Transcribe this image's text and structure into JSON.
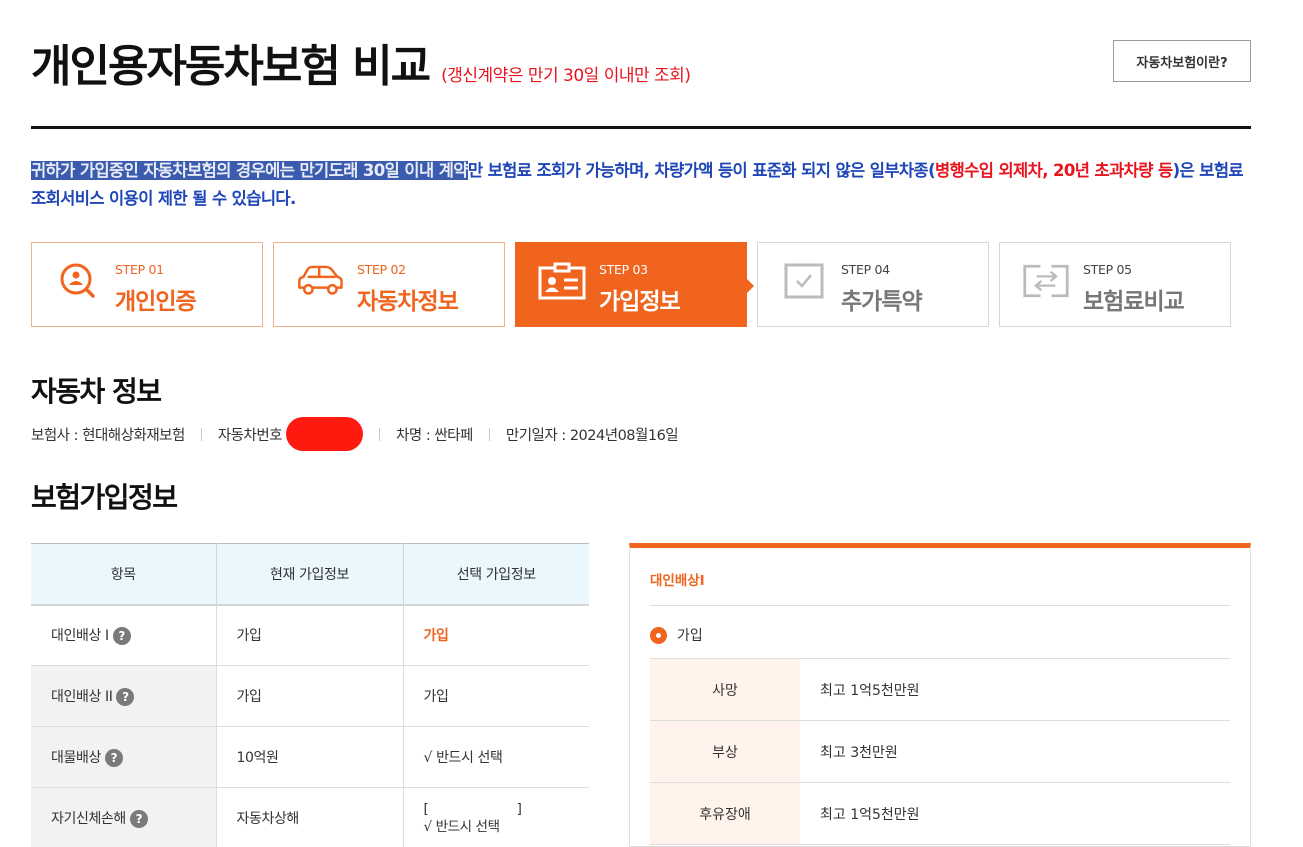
{
  "header": {
    "title": "개인용자동차보험 비교",
    "subtitle": "(갱신계약은 만기 30일 이내만 조회)",
    "about_button": "자동차보험이란?"
  },
  "notice": {
    "highlighted": "귀하가 가입중인 자동차보험의 경우에는 만기도래 30일 이내 계약",
    "part2": "만 보험료 조회가 가능하며, 차량가액 등이 표준화 되지 않은 일부차종(",
    "red": "병행수입 외제차, 20년 초과차량 등",
    "part3": ")은 보험료 조회서비스 이용이 제한 될 수 있습니다."
  },
  "steps": [
    {
      "num": "STEP 01",
      "name": "개인인증",
      "icon": "person-search-icon"
    },
    {
      "num": "STEP 02",
      "name": "자동차정보",
      "icon": "car-icon"
    },
    {
      "num": "STEP 03",
      "name": "가입정보",
      "icon": "id-card-icon"
    },
    {
      "num": "STEP 04",
      "name": "추가특약",
      "icon": "checkbox-icon"
    },
    {
      "num": "STEP 05",
      "name": "보험료비교",
      "icon": "compare-arrows-icon"
    }
  ],
  "car_section": {
    "heading": "자동차 정보",
    "insurer": "보험사 : 현대해상화재보험",
    "plate_label": "자동차번호",
    "car_name": "차명 : 싼타페",
    "expiry": "만기일자 : 2024년08월16일"
  },
  "insurance_section": {
    "heading": "보험가입정보",
    "columns": [
      "항목",
      "현재 가입정보",
      "선택 가입정보"
    ],
    "rows": [
      {
        "item": "대인배상 I",
        "current": "가입",
        "selected": "가입"
      },
      {
        "item": "대인배상 II",
        "current": "가입",
        "selected": "가입"
      },
      {
        "item": "대물배상",
        "current": "10억원",
        "selected": "√ 반드시 선택"
      },
      {
        "item": "자기신체손해",
        "current": "자동차상해",
        "selected_bracket_open": "[",
        "selected_bracket_close": "]",
        "selected": "√ 반드시 선택"
      }
    ]
  },
  "panel": {
    "title": "대인배상I",
    "option": "가입",
    "rows": [
      {
        "k": "사망",
        "v": "최고 1억5천만원"
      },
      {
        "k": "부상",
        "v": "최고 3천만원"
      },
      {
        "k": "후유장애",
        "v": "최고 1억5천만원"
      }
    ]
  },
  "colors": {
    "accent": "#f0641e",
    "notice_blue": "#1f46b7",
    "alert_red": "#e8141e",
    "table_head": "#eaf7fd"
  }
}
